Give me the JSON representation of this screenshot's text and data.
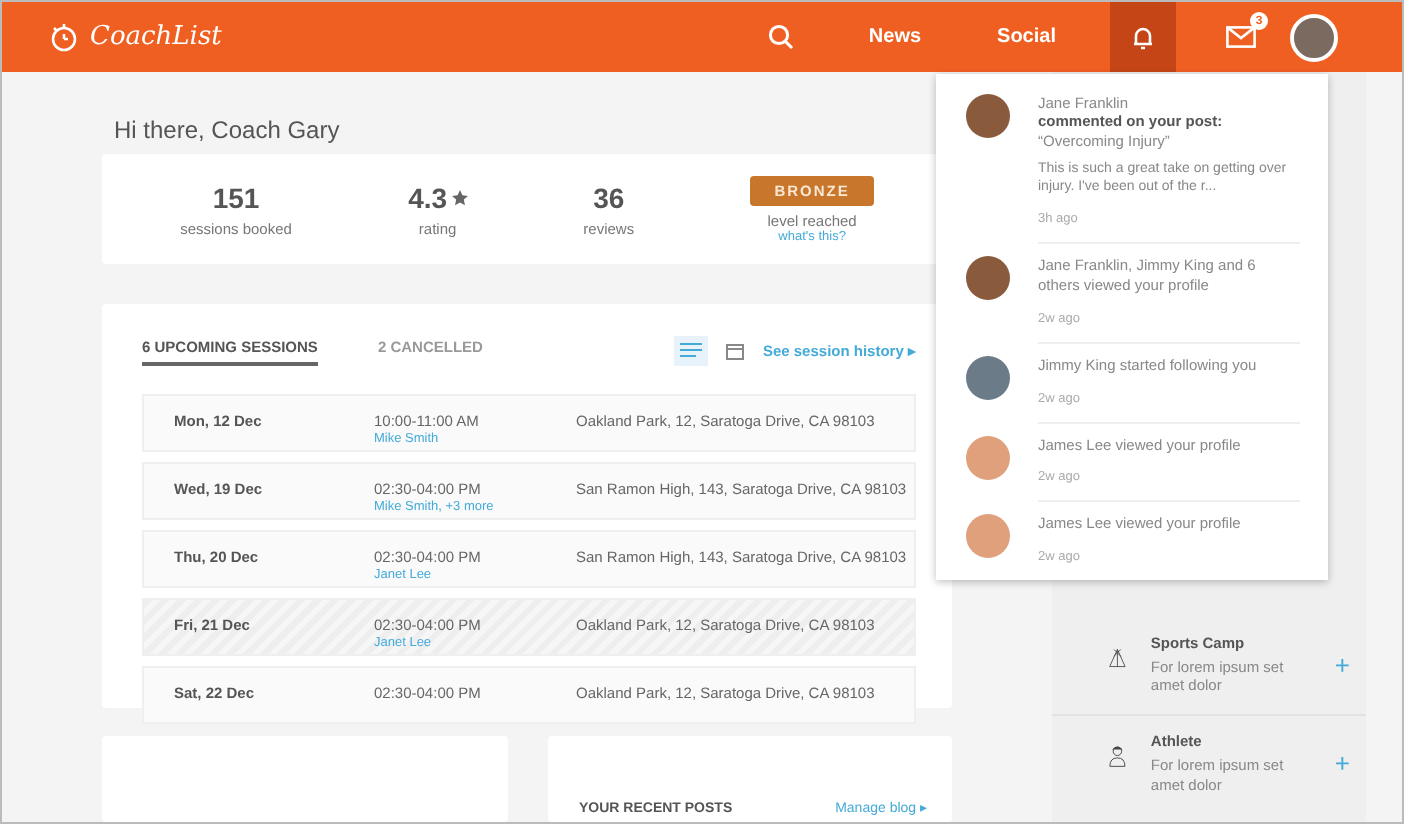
{
  "header": {
    "logo": "CoachList",
    "nav": [
      {
        "label": "News"
      },
      {
        "label": "Social"
      }
    ],
    "notifications_open": true,
    "mail_badge": "3"
  },
  "greeting": "Hi there, Coach Gary",
  "stats": [
    {
      "value": "151",
      "label": "sessions booked",
      "kind": "plain"
    },
    {
      "value": "4.3",
      "label": "rating",
      "kind": "rating"
    },
    {
      "value": "36",
      "label": "reviews",
      "kind": "plain"
    }
  ],
  "level": {
    "badge": "BRONZE",
    "label": "level reached",
    "link": "what's this?"
  },
  "sessions": {
    "tabs": [
      {
        "label": "6 UPCOMING SESSIONS",
        "selected": true
      },
      {
        "label": "2 CANCELLED",
        "selected": false
      }
    ],
    "views": [
      {
        "kind": "list",
        "selected": true
      },
      {
        "kind": "calendar",
        "selected": false
      }
    ],
    "history_link": "See session history ▸",
    "rows": [
      {
        "date": "Mon, 12 Dec",
        "time": "10:00-11:00 AM",
        "attendee": "Mike Smith",
        "location": "Oakland Park, 12, Saratoga Drive, CA 98103",
        "highlighted": false
      },
      {
        "date": "Wed, 19 Dec",
        "time": "02:30-04:00 PM",
        "attendee": "Mike Smith, +3 more",
        "location": "San Ramon High, 143, Saratoga Drive, CA 98103",
        "highlighted": false
      },
      {
        "date": "Thu, 20 Dec",
        "time": "02:30-04:00 PM",
        "attendee": "Janet Lee",
        "location": "San Ramon High, 143, Saratoga Drive, CA 98103",
        "highlighted": false
      },
      {
        "date": "Fri, 21 Dec",
        "time": "02:30-04:00 PM",
        "attendee": "Janet Lee",
        "location": "Oakland Park, 12, Saratoga Drive, CA 98103",
        "highlighted": true
      },
      {
        "date": "Sat, 22 Dec",
        "time": "02:30-04:00 PM",
        "location": "Oakland Park, 12, Saratoga Drive, CA 98103",
        "highlighted": false
      }
    ]
  },
  "recent_posts": {
    "title": "YOUR RECENT POSTS",
    "link": "Manage blog ▸"
  },
  "notifications": [
    {
      "name": "Jane Franklin",
      "text": "**commented on your post:** “Overcoming Injury”",
      "body": "This is such a great take on getting over injury. I've been out of the r...",
      "time": "3h ago"
    },
    {
      "text": "Jane Franklin, Jimmy King and 6 others viewed your profile",
      "time": "2w ago"
    },
    {
      "text": "Jimmy King started following you",
      "time": "2w ago"
    },
    {
      "text": "James Lee viewed your profile",
      "time": "2w ago"
    },
    {
      "text": "James Lee viewed your profile",
      "time": "2w ago"
    }
  ],
  "sidebar": [
    {
      "kind": "camp",
      "title": "Sports Camp",
      "description": "For lorem ipsum set amet dolor",
      "action": "+"
    },
    {
      "kind": "athlete",
      "title": "Athlete",
      "description": "For lorem ipsum set amet dolor",
      "action": "+"
    }
  ]
}
